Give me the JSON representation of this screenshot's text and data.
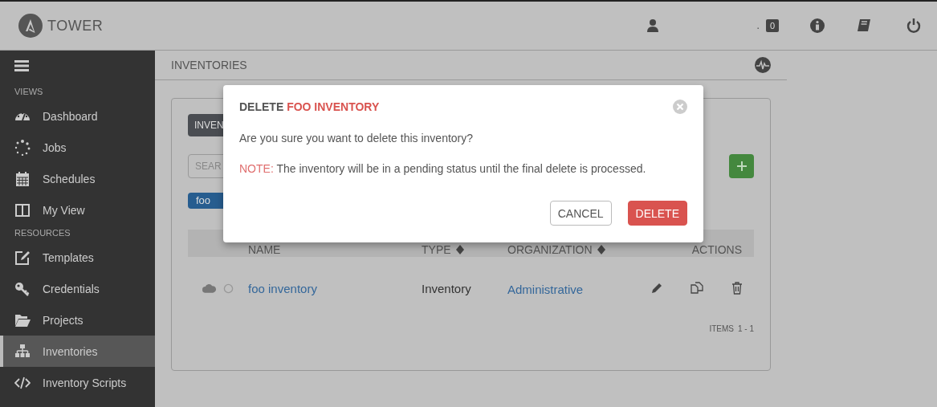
{
  "top_bar": {
    "brand": "TOWER",
    "label": ".",
    "badge": "0"
  },
  "sidebar": {
    "sections": [
      {
        "title": "VIEWS",
        "items": [
          {
            "label": "Dashboard",
            "selected": false
          },
          {
            "label": "Jobs",
            "selected": false
          },
          {
            "label": "Schedules",
            "selected": false
          },
          {
            "label": "My View",
            "selected": false
          }
        ]
      },
      {
        "title": "RESOURCES",
        "items": [
          {
            "label": "Templates",
            "selected": false
          },
          {
            "label": "Credentials",
            "selected": false
          },
          {
            "label": "Projects",
            "selected": false
          },
          {
            "label": "Inventories",
            "selected": true
          },
          {
            "label": "Inventory Scripts",
            "selected": false
          }
        ]
      }
    ]
  },
  "breadcrumb": "INVENTORIES",
  "card": {
    "tab": "INVEN",
    "search": {
      "placeholder": "SEAR"
    },
    "tag": "foo",
    "table": {
      "columns": [
        {
          "label": "NAME",
          "sortable": false
        },
        {
          "label": "TYPE",
          "sortable": true
        },
        {
          "label": "ORGANIZATION",
          "sortable": true
        },
        {
          "label": "ACTIONS",
          "sortable": false
        }
      ],
      "rows": [
        {
          "name": "foo inventory",
          "type": "Inventory",
          "organization": "Administrative"
        }
      ]
    },
    "footer": {
      "label": "ITEMS",
      "range": "1 - 1"
    }
  },
  "dialog": {
    "title": "DELETE",
    "title_highlight": "FOO INVENTORY",
    "message": "Are you sure you want to delete this inventory?",
    "note_label": "NOTE:",
    "note": "The inventory will be in a pending status until the final delete is processed.",
    "buttons": [
      {
        "label": "CANCEL",
        "kind": "secondary"
      },
      {
        "label": "DELETE",
        "kind": "danger"
      }
    ]
  }
}
